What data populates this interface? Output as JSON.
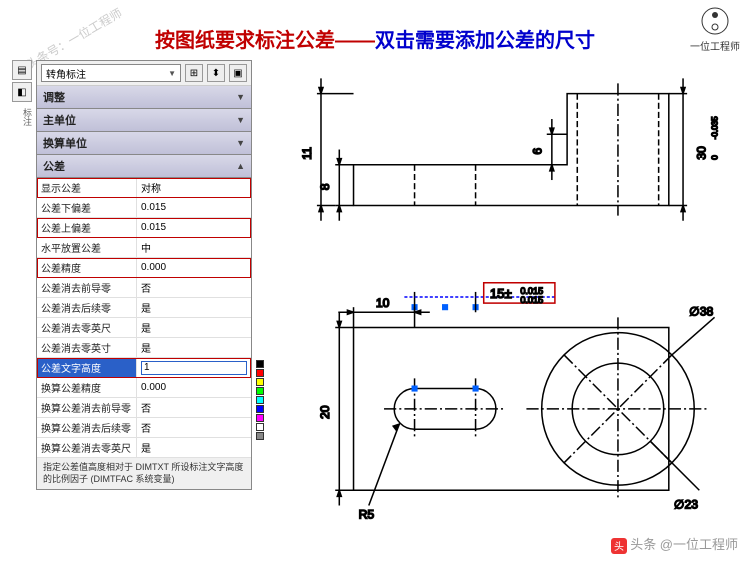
{
  "watermark_left": "头条号：一位工程师",
  "logo_caption": "一位工程师",
  "title_red": "按图纸要求标注公差——",
  "title_blue": "双击需要添加公差的尺寸",
  "watermark_br": "头条 @一位工程师",
  "combo_text": "转角标注",
  "sections": {
    "adjust": "调整",
    "main_unit": "主单位",
    "alt_unit": "换算单位",
    "tolerance": "公差"
  },
  "props": [
    {
      "label": "显示公差",
      "value": "对称",
      "red": true
    },
    {
      "label": "公差下偏差",
      "value": "0.015"
    },
    {
      "label": "公差上偏差",
      "value": "0.015",
      "red": true
    },
    {
      "label": "水平放置公差",
      "value": "中"
    },
    {
      "label": "公差精度",
      "value": "0.000",
      "red": true
    },
    {
      "label": "公差消去前导零",
      "value": "否"
    },
    {
      "label": "公差消去后续零",
      "value": "是"
    },
    {
      "label": "公差消去零英尺",
      "value": "是"
    },
    {
      "label": "公差消去零英寸",
      "value": "是"
    },
    {
      "label": "公差文字高度",
      "value": "1",
      "selected": true,
      "red": true
    },
    {
      "label": "换算公差精度",
      "value": "0.000"
    },
    {
      "label": "换算公差消去前导零",
      "value": "否"
    },
    {
      "label": "换算公差消去后续零",
      "value": "否"
    },
    {
      "label": "换算公差消去零英尺",
      "value": "是"
    }
  ],
  "help_text": "指定公差值高度相对于 DIMTXT 所设标注文字高度的比例因子 (DIMTFAC 系统变量)",
  "dims": {
    "d10": "10",
    "d6": "6",
    "d11": "11",
    "d8": "8",
    "d20": "20",
    "d30": "30",
    "tol30": "0\n-0.035",
    "d15": "15±",
    "d15tol": "0.015",
    "phi38": "∅38",
    "phi23": "∅23",
    "r5": "R5"
  }
}
